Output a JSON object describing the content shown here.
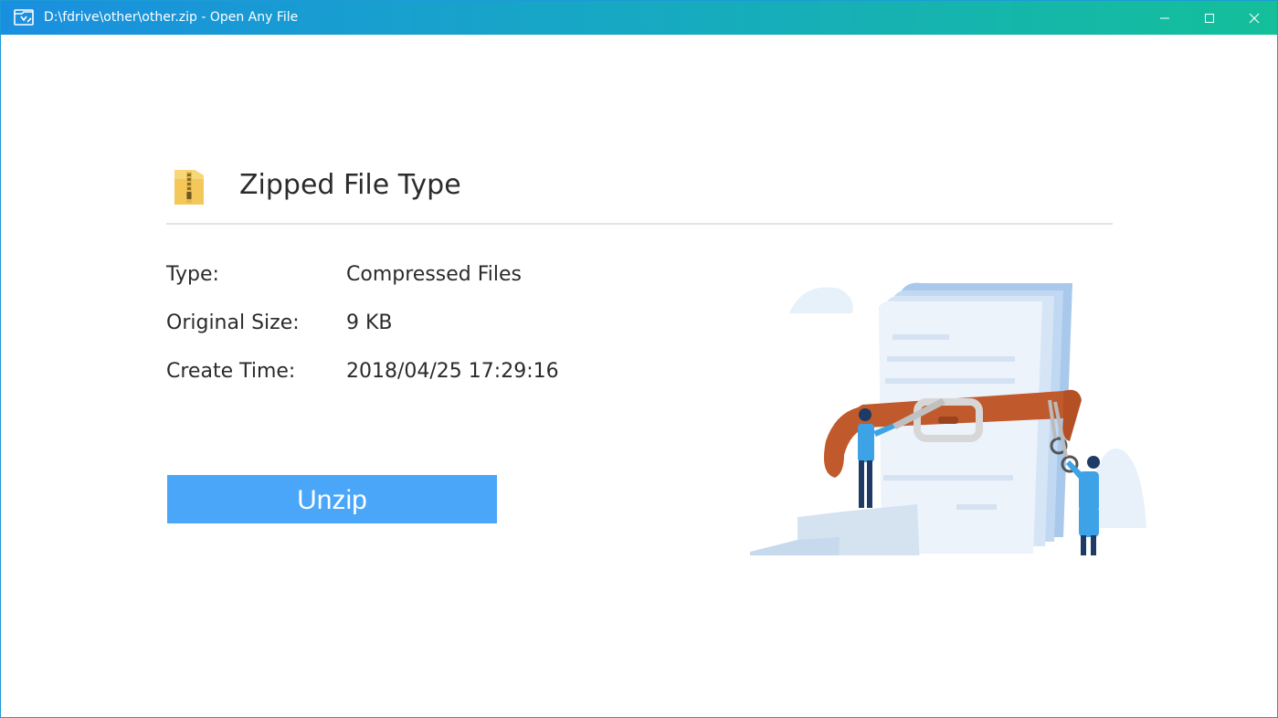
{
  "window": {
    "title": "D:\\fdrive\\other\\other.zip - Open Any File",
    "app_icon": "open-any-file-app-icon",
    "controls": {
      "minimize_icon": "minimize-icon",
      "maximize_icon": "maximize-icon",
      "close_icon": "close-icon"
    },
    "accent_colors": [
      "#1a8fe0",
      "#14bf9a"
    ]
  },
  "file": {
    "icon": "zip-folder-icon",
    "heading": "Zipped File Type",
    "properties": [
      {
        "label": "Type:",
        "value": "Compressed Files"
      },
      {
        "label": "Original Size:",
        "value": "9 KB"
      },
      {
        "label": "Create Time:",
        "value": "2018/04/25 17:29:16"
      }
    ]
  },
  "actions": {
    "unzip_label": "Unzip",
    "unzip_color": "#4aa6f8"
  },
  "illustration": {
    "name": "compressed-document-belt-illustration"
  }
}
